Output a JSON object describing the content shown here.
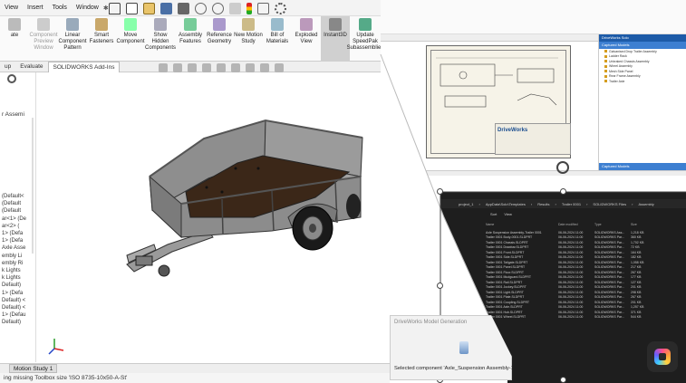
{
  "menubar": {
    "items": [
      "View",
      "Insert",
      "Tools",
      "Window"
    ]
  },
  "ribbon": {
    "commands": [
      {
        "label": "ate",
        "dim": false
      },
      {
        "label": "Component Preview Window",
        "dim": true
      },
      {
        "label": "Linear Component Pattern",
        "dim": false
      },
      {
        "label": "Smart Fasteners",
        "dim": false
      },
      {
        "label": "Move Component",
        "dim": false
      },
      {
        "label": "Show Hidden Components",
        "dim": false
      },
      {
        "label": "Assembly Features",
        "dim": false
      },
      {
        "label": "Reference Geometry",
        "dim": false
      },
      {
        "label": "New Motion Study",
        "dim": false
      },
      {
        "label": "Bill of Materials",
        "dim": false
      },
      {
        "label": "Exploded View",
        "dim": false
      },
      {
        "label": "Instant3D",
        "dim": false,
        "selected": true
      },
      {
        "label": "Update SpeedPak Subassemblies",
        "dim": false
      }
    ]
  },
  "tabs": {
    "items": [
      "up",
      "Evaluate",
      "SOLIDWORKS Add-Ins"
    ]
  },
  "feature_tree": {
    "heading": "r Assemi",
    "items": [
      "(Default<",
      "(Default",
      "(Default",
      "ar<1> (De",
      "ar<2> (",
      "1> (Defa",
      "1> (Defa",
      "Axle Asse",
      "embly Li",
      "embly Ri",
      "k Lights",
      "k Lights",
      "Default)",
      "1> (Defa",
      "Default) <",
      "Default) <",
      "1> (Defau",
      "Default)"
    ]
  },
  "bottom": {
    "tab": "Motion Study 1",
    "status": "ing missing Toolbox size 'ISO 8735-10x50-A-St'"
  },
  "drawing": {
    "logo": "DriveWorks"
  },
  "right_panel": {
    "header": "DriveWorks Solo",
    "subheader": "Captured Models",
    "items": [
      "Galvanised Drop Trailer Assembly",
      "Ladder Rack",
      "Unbraked Chassis Assembly",
      "Wheel Assembly",
      "Mesh Side Panel",
      "Rear Frame Assembly",
      "Trailer Axle"
    ],
    "footer": "Captured Models"
  },
  "explorer": {
    "path": [
      "project_1",
      "AppData\\Solo\\Templates",
      "Results",
      "Trailer 0001",
      "SOLIDWORKS Files",
      "Assembly"
    ],
    "toolbar": [
      "Sort",
      "View"
    ],
    "columns": [
      "Name",
      "Date modified",
      "Type",
      "Size"
    ],
    "rows": [
      {
        "name": "Axle Suspension Assembly-Trailer 0001",
        "date": "06-06-2024 11:00",
        "type": "SOLIDWORKS Ass...",
        "size": "1,218 KB"
      },
      {
        "name": "Trailer 0001 Body-0001.SLDPRT",
        "date": "06-06-2024 11:00",
        "type": "SOLIDWORKS Par...",
        "size": "360 KB"
      },
      {
        "name": "Trailer 0001 Chassis.SLDPRT",
        "date": "06-06-2024 11:00",
        "type": "SOLIDWORKS Par...",
        "size": "1,702 KB"
      },
      {
        "name": "Trailer 0001 Drawbar.SLDPRT",
        "date": "06-06-2024 11:00",
        "type": "SOLIDWORKS Par...",
        "size": "72 KB"
      },
      {
        "name": "Trailer 0001 Front.SLDPRT",
        "date": "06-06-2024 11:00",
        "type": "SOLIDWORKS Par...",
        "size": "164 KB"
      },
      {
        "name": "Trailer 0001 Side.SLDPRT",
        "date": "06-06-2024 11:00",
        "type": "SOLIDWORKS Par...",
        "size": "182 KB"
      },
      {
        "name": "Trailer 0001 Tailgate.SLDPRT",
        "date": "06-06-2024 11:00",
        "type": "SOLIDWORKS Par...",
        "size": "1,058 KB"
      },
      {
        "name": "Trailer 0001 Panel.SLDPRT",
        "date": "06-06-2024 11:00",
        "type": "SOLIDWORKS Par...",
        "size": "217 KB"
      },
      {
        "name": "Trailer 0001 Floor.SLDPRT",
        "date": "06-06-2024 11:00",
        "type": "SOLIDWORKS Par...",
        "size": "267 KB"
      },
      {
        "name": "Trailer 0001 Mudguard.SLDPRT",
        "date": "06-06-2024 11:00",
        "type": "SOLIDWORKS Par...",
        "size": "177 KB"
      },
      {
        "name": "Trailer 0001 Rail.SLDPRT",
        "date": "06-06-2024 11:00",
        "type": "SOLIDWORKS Par...",
        "size": "127 KB"
      },
      {
        "name": "Trailer 0001 Jockey.SLDPRT",
        "date": "06-06-2024 11:00",
        "type": "SOLIDWORKS Par...",
        "size": "201 KB"
      },
      {
        "name": "Trailer 0001 Light.SLDPRT",
        "date": "06-06-2024 11:00",
        "type": "SOLIDWORKS Par...",
        "size": "298 KB"
      },
      {
        "name": "Trailer 0001 Plate.SLDPRT",
        "date": "06-06-2024 11:00",
        "type": "SOLIDWORKS Par...",
        "size": "267 KB"
      },
      {
        "name": "Trailer 0001 Coupling.SLDPRT",
        "date": "06-06-2024 11:00",
        "type": "SOLIDWORKS Par...",
        "size": "201 KB"
      },
      {
        "name": "Trailer 0001 Axle.SLDPRT",
        "date": "06-06-2024 11:00",
        "type": "SOLIDWORKS Par...",
        "size": "1,257 KB"
      },
      {
        "name": "Trailer 0001 Hub.SLDPRT",
        "date": "06-06-2024 11:00",
        "type": "SOLIDWORKS Par...",
        "size": "371 KB"
      },
      {
        "name": "Trailer 0001 Wheel.SLDPRT",
        "date": "06-06-2024 11:00",
        "type": "SOLIDWORKS Par...",
        "size": "544 KB"
      }
    ]
  },
  "dwmg": {
    "title": "DriveWorks Model Generation",
    "message": "Selected component 'Axle_Suspension Assembly-1'."
  },
  "colors": {
    "accent_blue": "#1d5ba8",
    "floor_brown": "#3b2718",
    "body_gray": "#8a8a8a",
    "dark_bg": "#1e1e1e"
  }
}
